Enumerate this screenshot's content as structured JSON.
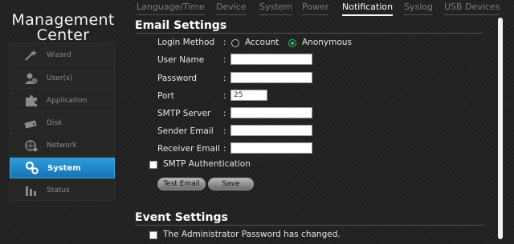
{
  "app": {
    "title_line1": "Management",
    "title_line2": "Center"
  },
  "sidebar": {
    "items": [
      {
        "label": "Wizard",
        "icon": "wand-icon"
      },
      {
        "label": "User(s)",
        "icon": "users-icon"
      },
      {
        "label": "Application",
        "icon": "puzzle-icon"
      },
      {
        "label": "Disk",
        "icon": "disk-icon"
      },
      {
        "label": "Network",
        "icon": "network-icon"
      },
      {
        "label": "System",
        "icon": "gears-icon"
      },
      {
        "label": "Status",
        "icon": "status-bars-icon"
      }
    ],
    "active_index": 5
  },
  "tabs": [
    {
      "label": "Language/Time"
    },
    {
      "label": "Device"
    },
    {
      "label": "System"
    },
    {
      "label": "Power"
    },
    {
      "label": "Notification"
    },
    {
      "label": "Syslog"
    },
    {
      "label": "USB Devices"
    }
  ],
  "active_tab": "Notification",
  "email_settings": {
    "title": "Email Settings",
    "login_method_label": "Login Method",
    "login_options": [
      {
        "label": "Account",
        "selected": false
      },
      {
        "label": "Anonymous",
        "selected": true
      }
    ],
    "fields": {
      "user_name": {
        "label": "User Name",
        "value": ""
      },
      "password": {
        "label": "Password",
        "value": ""
      },
      "port": {
        "label": "Port",
        "value": "25"
      },
      "smtp_server": {
        "label": "SMTP Server",
        "value": ""
      },
      "sender_email": {
        "label": "Sender Email",
        "value": ""
      },
      "receiver_email": {
        "label": "Receiver Email",
        "value": ""
      }
    },
    "colon": ":",
    "smtp_auth_label": "SMTP Authentication",
    "smtp_auth_checked": false,
    "test_email_button": "Test Email",
    "save_button": "Save"
  },
  "event_settings": {
    "title": "Event Settings",
    "items": [
      {
        "label": "The Administrator Password has changed.",
        "checked": false
      }
    ]
  },
  "colors": {
    "active_nav": "#1e88cc",
    "radio_selected": "#2cc96a",
    "background": "#222222"
  }
}
